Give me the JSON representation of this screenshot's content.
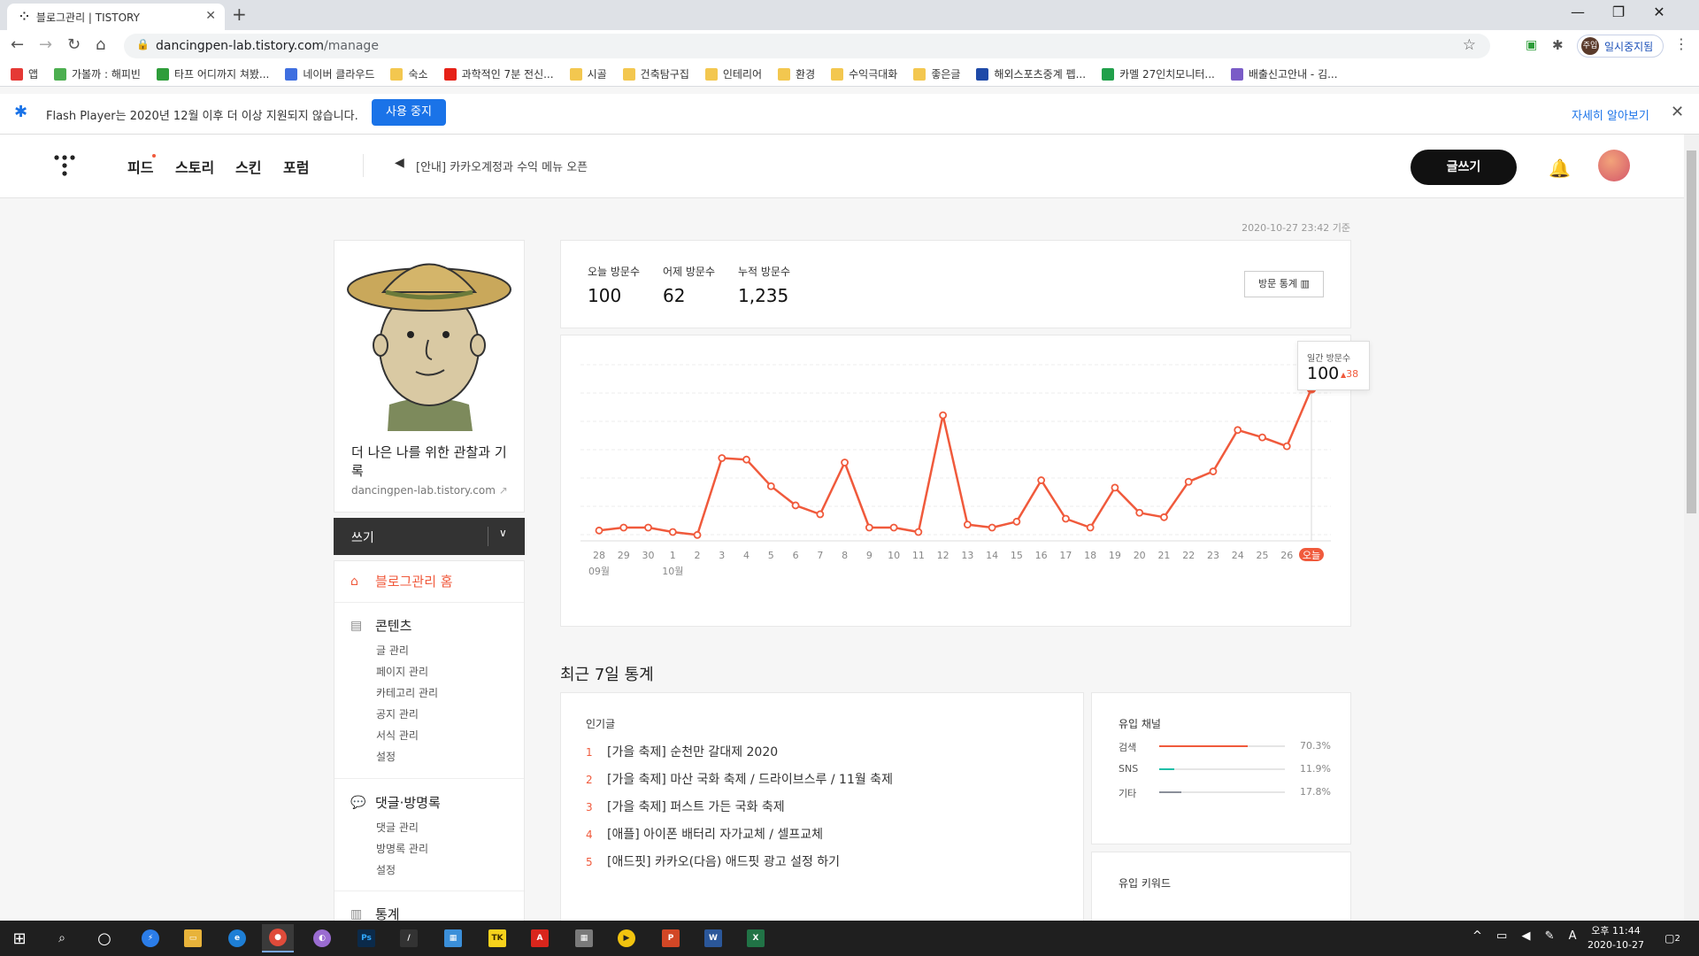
{
  "browser": {
    "tab_title": "블로그관리 | TISTORY",
    "url_host": "dancingpen-lab.tistory.com",
    "url_path": "/manage",
    "profile_label": "일시중지됨",
    "profile_avatar": "주입"
  },
  "bookmarks": [
    {
      "label": "앱",
      "color": "#e53935"
    },
    {
      "label": "가볼까 : 해피빈",
      "color": "#4caf50"
    },
    {
      "label": "타프 어디까지 쳐봤...",
      "color": "#2e9d3a"
    },
    {
      "label": "네이버 클라우드",
      "color": "#3f6fe0"
    },
    {
      "label": "숙소",
      "color": "#f3c74f"
    },
    {
      "label": "과학적인 7분 전신...",
      "color": "#e62117"
    },
    {
      "label": "시골",
      "color": "#f3c74f"
    },
    {
      "label": "건축탐구집",
      "color": "#f3c74f"
    },
    {
      "label": "인테리어",
      "color": "#f3c74f"
    },
    {
      "label": "환경",
      "color": "#f3c74f"
    },
    {
      "label": "수익극대화",
      "color": "#f3c74f"
    },
    {
      "label": "좋은글",
      "color": "#f3c74f"
    },
    {
      "label": "해외스포츠중계 펩...",
      "color": "#1f4aa8"
    },
    {
      "label": "카멜 27인치모니터...",
      "color": "#21a04b"
    },
    {
      "label": "배출신고안내 - 김...",
      "color": "#7a5cc7"
    }
  ],
  "infobar": {
    "message": "Flash Player는 2020년 12월 이후 더 이상 지원되지 않습니다.",
    "button": "사용 중지",
    "more": "자세히 알아보기"
  },
  "header": {
    "nav": [
      "피드",
      "스토리",
      "스킨",
      "포럼"
    ],
    "notice": "[안내] 카카오계정과 수익 메뉴 오픈",
    "write": "글쓰기"
  },
  "timestamp": "2020-10-27 23:42 기준",
  "blog": {
    "name": "더 나은 나를 위한 관찰과 기록",
    "url": "dancingpen-lab.tistory.com"
  },
  "writebar": {
    "label": "쓰기"
  },
  "sidemenu": {
    "home": "블로그관리 홈",
    "contents": {
      "title": "콘텐츠",
      "items": [
        "글 관리",
        "페이지 관리",
        "카테고리 관리",
        "공지 관리",
        "서식 관리",
        "설정"
      ]
    },
    "comments": {
      "title": "댓글·방명록",
      "items": [
        "댓글 관리",
        "방명록 관리",
        "설정"
      ]
    },
    "stats": {
      "title": "통계"
    }
  },
  "visits": {
    "today_label": "오늘 방문수",
    "today": "100",
    "yesterday_label": "어제 방문수",
    "yesterday": "62",
    "total_label": "누적 방문수",
    "total": "1,235",
    "stat_button": "방문 통계"
  },
  "tooltip": {
    "label": "일간 방문수",
    "value": "100",
    "delta": "38"
  },
  "chart_data": {
    "type": "line",
    "categories": [
      "28",
      "29",
      "30",
      "1",
      "2",
      "3",
      "4",
      "5",
      "6",
      "7",
      "8",
      "9",
      "10",
      "11",
      "12",
      "13",
      "14",
      "15",
      "16",
      "17",
      "18",
      "19",
      "20",
      "21",
      "22",
      "23",
      "24",
      "25",
      "26",
      "오늘"
    ],
    "month_labels": [
      {
        "index": 0,
        "text": "09월"
      },
      {
        "index": 3,
        "text": "10월"
      }
    ],
    "values": [
      4,
      6,
      6,
      3,
      1,
      53,
      52,
      34,
      21,
      15,
      50,
      6,
      6,
      3,
      82,
      8,
      6,
      10,
      38,
      12,
      6,
      33,
      16,
      13,
      37,
      44,
      72,
      67,
      61,
      100
    ],
    "ylim": [
      0,
      115
    ],
    "color": "#f05a3c"
  },
  "recent": {
    "title": "최근 7일 통계",
    "popular_title": "인기글",
    "popular": [
      {
        "rank": "1",
        "title": "[가을 축제] 순천만 갈대제 2020"
      },
      {
        "rank": "2",
        "title": "[가을 축제] 마산 국화 축제 / 드라이브스루 / 11월 축제"
      },
      {
        "rank": "3",
        "title": "[가을 축제] 퍼스트 가든 국화 축제"
      },
      {
        "rank": "4",
        "title": "[애플] 아이폰 배터리 자가교체 / 셀프교체"
      },
      {
        "rank": "5",
        "title": "[애드핏] 카카오(다음) 애드핏 광고 설정 하기"
      }
    ],
    "channel_title": "유입 채널",
    "channels": [
      {
        "name": "검색",
        "pct": "70.3%",
        "value": 70.3,
        "color": "#f05a3c"
      },
      {
        "name": "SNS",
        "pct": "11.9%",
        "value": 11.9,
        "color": "#1fbfa8"
      },
      {
        "name": "기타",
        "pct": "17.8%",
        "value": 17.8,
        "color": "#8a8f99"
      }
    ],
    "keyword_title": "유입 키워드"
  },
  "taskbar": {
    "time": "오후 11:44",
    "date": "2020-10-27",
    "ime": "A",
    "notif": "2"
  }
}
